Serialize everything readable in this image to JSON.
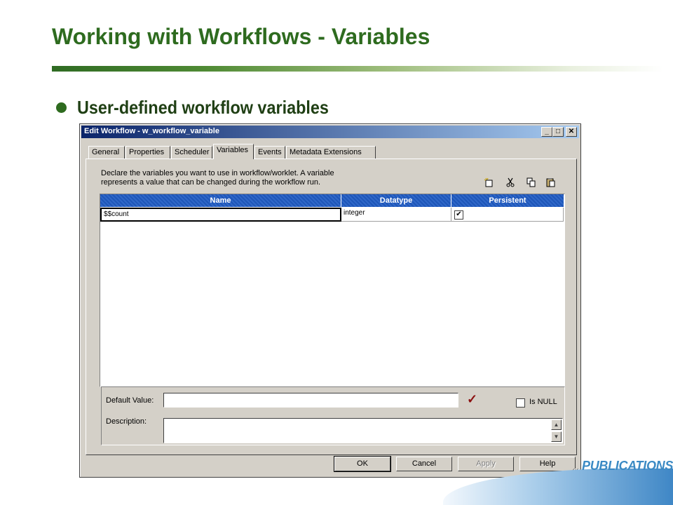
{
  "slide": {
    "title": "Working with Workflows - Variables",
    "bullet": "User-defined workflow variables",
    "logo_text": "PUBLICATIONS"
  },
  "dialog": {
    "title": "Edit Workflow - w_workflow_variable",
    "window_buttons": {
      "minimize": "_",
      "maximize": "□",
      "close": "✕"
    },
    "tabs": [
      {
        "label": "General"
      },
      {
        "label": "Properties"
      },
      {
        "label": "Scheduler"
      },
      {
        "label": "Variables",
        "active": true
      },
      {
        "label": "Events"
      },
      {
        "label": "Metadata Extensions"
      }
    ],
    "description_lines": [
      "Declare the variables you want to use in workflow/worklet.  A variable",
      "represents a value that can be changed during the workflow run."
    ],
    "toolbar_icons": [
      "new-icon",
      "cut-icon",
      "copy-icon",
      "paste-icon"
    ],
    "grid": {
      "columns": [
        "Name",
        "Datatype",
        "Persistent"
      ],
      "rows": [
        {
          "name": "$$count",
          "datatype": "integer",
          "persistent": true
        }
      ]
    },
    "default_value_label": "Default Value:",
    "default_value": "",
    "is_null_label": "Is NULL",
    "is_null_checked": false,
    "description_label": "Description:",
    "description_value": "",
    "buttons": {
      "ok": "OK",
      "cancel": "Cancel",
      "apply": "Apply",
      "help": "Help"
    }
  },
  "colors": {
    "title_green": "#2e6b1f",
    "titlebar_blue": "#0a246a",
    "header_blue": "#2a62c4",
    "logo_blue": "#3b8ac4",
    "dialog_gray": "#d4d0c8"
  }
}
